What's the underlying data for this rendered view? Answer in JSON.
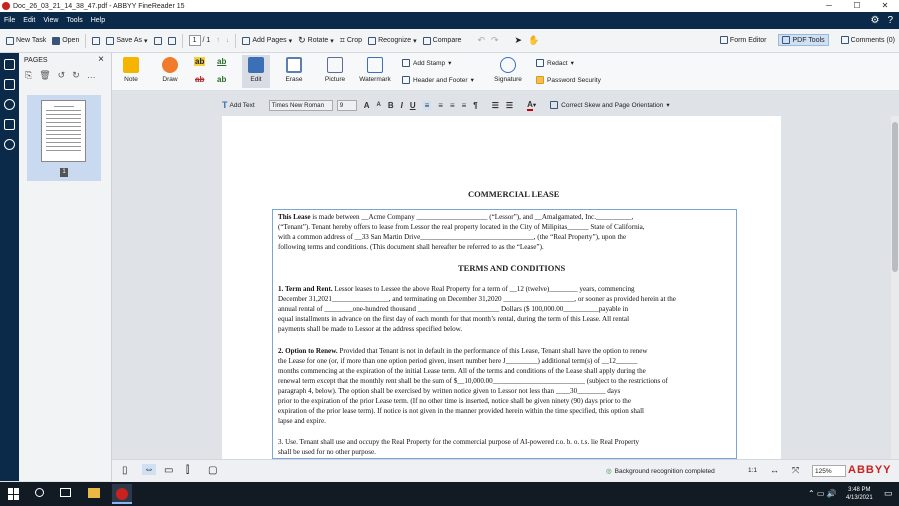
{
  "window": {
    "title": "Doc_26_03_21_14_38_47.pdf - ABBYY FineReader 15"
  },
  "menu": [
    "File",
    "Edit",
    "View",
    "Tools",
    "Help"
  ],
  "toolbar": {
    "new_task": "New Task",
    "open": "Open",
    "save_as": "Save As",
    "page_current": "1",
    "page_total": "/ 1",
    "add_pages": "Add Pages",
    "rotate": "Rotate",
    "crop": "Crop",
    "recognize": "Recognize",
    "compare": "Compare",
    "form_editor": "Form Editor",
    "pdf_tools": "PDF Tools",
    "comments": "Comments (0)"
  },
  "pages_panel": {
    "title": "PAGES",
    "page_number": "1"
  },
  "ribbon": {
    "note": "Note",
    "draw": "Draw",
    "edit": "Edit",
    "erase": "Erase",
    "picture": "Picture",
    "watermark": "Watermark",
    "add_stamp": "Add Stamp",
    "header_footer": "Header and Footer",
    "signature": "Signature",
    "redact": "Redact",
    "password_security": "Password Security"
  },
  "format_bar": {
    "add_text": "Add Text",
    "font": "Times New Roman",
    "size": "9",
    "skew": "Correct Skew and Page Orientation"
  },
  "document": {
    "title": "COMMERCIAL LEASE",
    "l1a": "This Lease",
    "l1b": " is made between __Acme Company ____________________ (“Lessor”), and __Amalgamated, Inc.__________,",
    "l2": "(“Tenant”).  Tenant hereby offers to lease from Lessor the real property located in the City of Milipitas______ State of California,",
    "l3": "with a common address of __33 San Martin Drive________________________________, (the “Real Property”), upon the",
    "l4": "following terms and conditions.  (This document shall hereafter be referred to as the “Lease”).",
    "terms_heading": "TERMS AND CONDITIONS",
    "s1a": "1.   Term and Rent.",
    "s1b": "  Lessor leases to Lessee the above Real Property for a term of __12 (twelve)________ years, commencing",
    "s1c": "December 31,2021________________, and terminating on December 31,2020 ____________________, or sooner as provided herein at the",
    "s1d": "annual rental of ________one-hundred thousand _______________________ Dollars ($ 100,000.00__________payable in",
    "s1e": "equal installments in advance on the first day of each month for that month’s rental, during the term of this Lease.  All rental",
    "s1f": "payments shall be made to Lessor at the address specified below.",
    "s2a": "2.   Option to Renew.",
    "s2b": "  Provided that Tenant is not in default in the performance of this Lease, Tenant shall have the option to renew",
    "s2c": "the Lease for one (or, if more than one option period given, insert number here J_________) additional term(s) of __12______",
    "s2d": "months commencing at the expiration of the initial Lease term.  All of the terms and conditions of the Lease shall apply during the",
    "s2e": "renewal term except that the monthly rent shall be the sum of $__10,000.00__________________________ (subject to the restrictions of",
    "s2f": "paragraph 4, below).  The option shall be exercised by written notice given to Lessor not less than ____30________ days",
    "s2g": "prior to the expiration of the prior Lease term.  (If no other time is inserted, notice shall be given ninety (90) days prior to the",
    "s2h": "expiration of the prior lease term).  If notice is not given in the manner provided herein within the time specified, this option shall",
    "s2i": "lapse and expire.",
    "s3a": "3.   Use.  Tenant shall use and occupy the Real Property for the commercial purpose of  AI-powered r.o. b. o. t.s.   lie Real Property",
    "s3b": "shall be used for no other purpose."
  },
  "status": {
    "background": "Background recognition completed",
    "ratio": "1:1",
    "zoom": "125%",
    "brand": "ABBYY"
  },
  "taskbar": {
    "time": "3:48 PM",
    "date": "4/13/2021"
  },
  "colors": {
    "navy": "#0b2a4a",
    "brand_red": "#c8211e",
    "accent": "#3a5478"
  }
}
